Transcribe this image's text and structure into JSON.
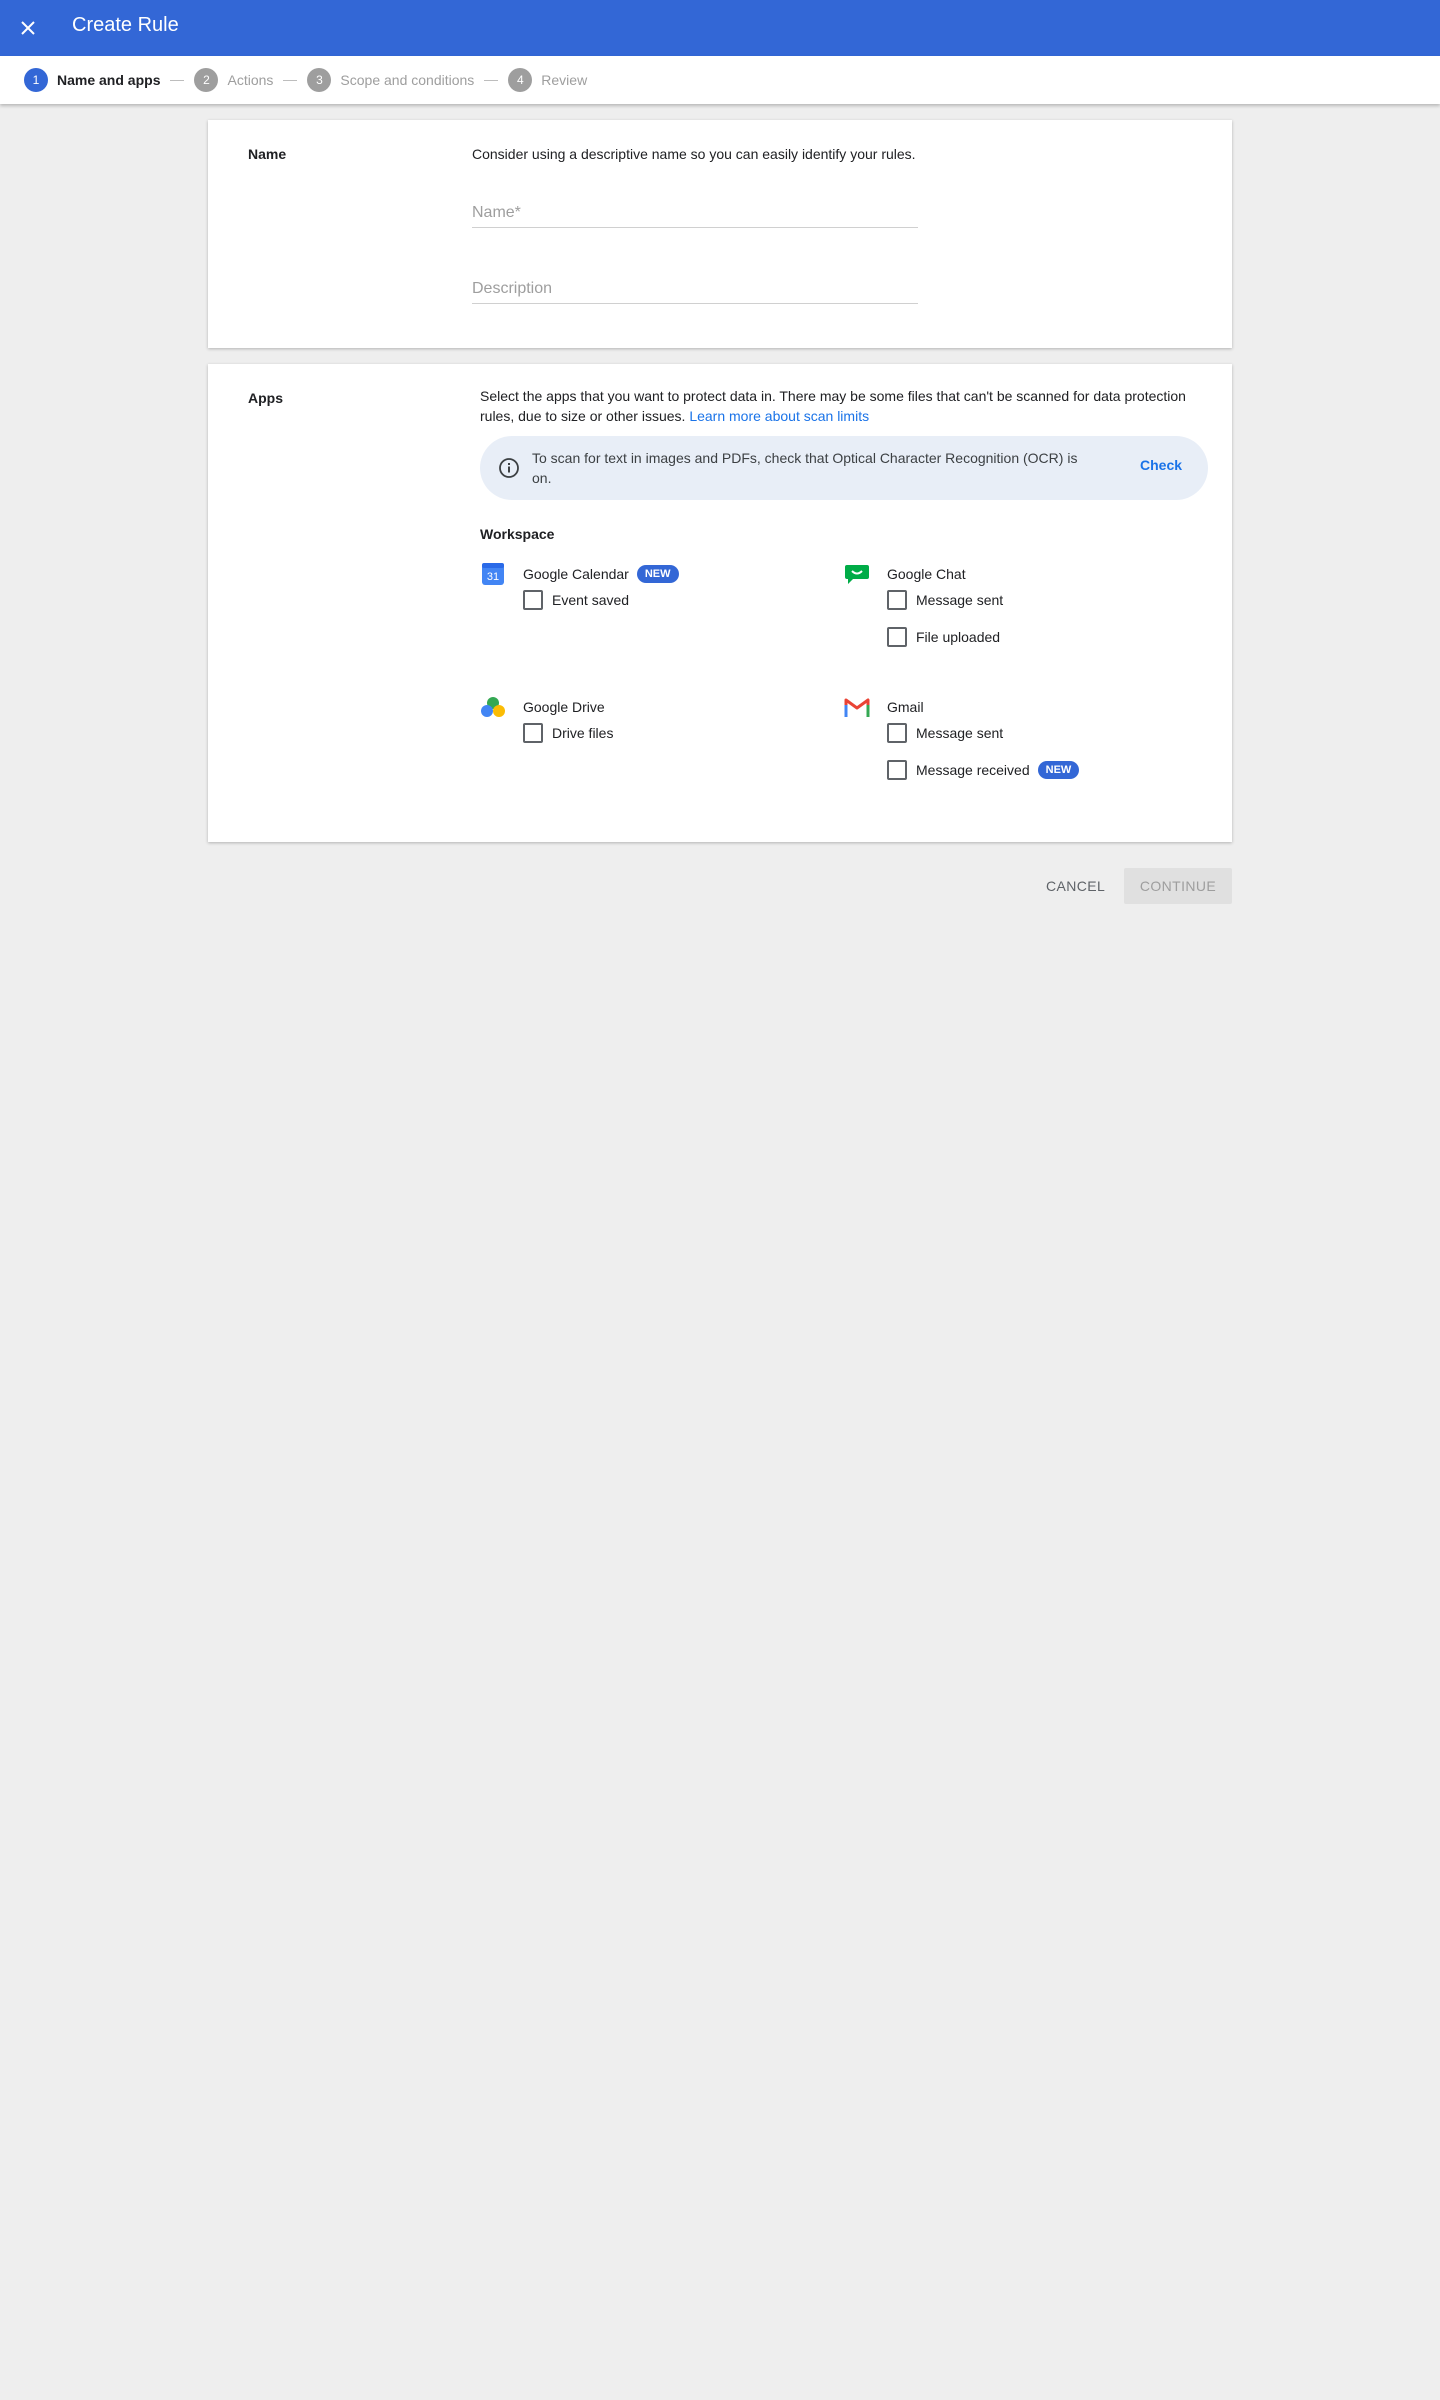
{
  "header": {
    "title": "Create Rule"
  },
  "stepper": {
    "steps": [
      {
        "number": "1",
        "label": "Name and apps"
      },
      {
        "number": "2",
        "label": "Actions"
      },
      {
        "number": "3",
        "label": "Scope and conditions"
      },
      {
        "number": "4",
        "label": "Review"
      }
    ]
  },
  "name_section": {
    "label": "Name",
    "hint": "Consider using a descriptive name so you can easily identify your rules.",
    "name_placeholder": "Name*",
    "name_value": "",
    "description_placeholder": "Description",
    "description_value": ""
  },
  "apps_section": {
    "label": "Apps",
    "description": "Select the apps that you want to protect data in. There may be some files that can't be scanned for data protection rules, due to size or other issues.",
    "learn_more": "Learn more about scan limits",
    "ocr_banner": {
      "text": "To scan for text in images and PDFs, check that Optical Character Recognition (OCR) is on.",
      "action": "Check"
    },
    "workspace_label": "Workspace",
    "apps": {
      "calendar": {
        "name": "Google Calendar",
        "badge": "NEW",
        "icon_text": "31",
        "options": [
          "Event saved"
        ]
      },
      "chat": {
        "name": "Google Chat",
        "options": [
          "Message sent",
          "File uploaded"
        ]
      },
      "drive": {
        "name": "Google Drive",
        "options": [
          "Drive files"
        ]
      },
      "gmail": {
        "name": "Gmail",
        "options": [
          "Message sent",
          "Message received"
        ],
        "option_badge": "NEW"
      }
    }
  },
  "footer": {
    "cancel": "CANCEL",
    "continue": "CONTINUE"
  },
  "colors": {
    "primary": "#3367d6",
    "link": "#1a73e8",
    "background": "#eeeeee"
  }
}
